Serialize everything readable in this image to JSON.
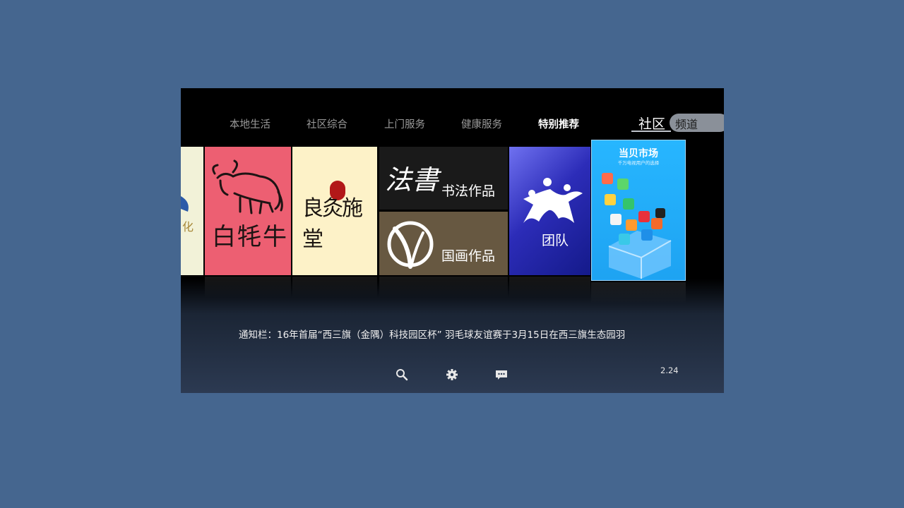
{
  "tabs": [
    {
      "label": "本地生活"
    },
    {
      "label": "社区综合"
    },
    {
      "label": "上门服务"
    },
    {
      "label": "健康服务"
    },
    {
      "label": "特别推荐",
      "active": true
    }
  ],
  "brand": {
    "main": "社区",
    "sub": "频道"
  },
  "tiles": {
    "partial_text": "化",
    "yak_text": "白牦牛",
    "moxi_text": "良灸施堂",
    "shufa_calligraphy": "法書",
    "shufa_label": "书法作品",
    "guohua_label": "国画作品",
    "team_label": "团队",
    "market_title": "当贝市场",
    "market_sub": "千万电视用户的选择"
  },
  "notice": {
    "prefix": "通知栏：",
    "text": "16年首届“西三旗（金隅）科技园区杯” 羽毛球友谊赛于3月15日在西三旗生态园羽"
  },
  "bottom_bar": {
    "icons": [
      "search-icon",
      "gear-icon",
      "message-icon"
    ],
    "version": "2.24"
  },
  "colors": {
    "background": "#45668f",
    "active_tab": "#ffffff",
    "inactive_tab": "#9a9a9a"
  }
}
